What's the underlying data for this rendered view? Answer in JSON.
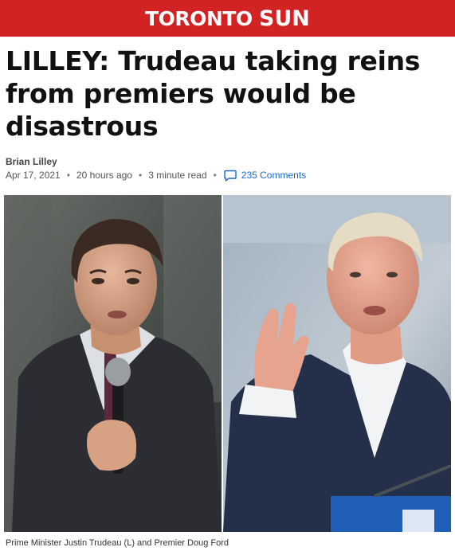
{
  "masthead": {
    "logo_prefix": "TORONTO",
    "logo_brand": "SUN",
    "color": "#d12224"
  },
  "article": {
    "headline": "LILLEY: Trudeau taking reins from premiers would be disastrous",
    "author": "Brian Lilley",
    "date": "Apr 17, 2021",
    "relative_time": "20 hours ago",
    "read_time": "3 minute read",
    "separator": "•",
    "comments": "235 Comments",
    "comments_icon": "comment-bubble-icon",
    "link_color": "#1a66c9"
  },
  "photo": {
    "caption": "Prime Minister Justin Trudeau (L) and Premier Doug Ford"
  }
}
